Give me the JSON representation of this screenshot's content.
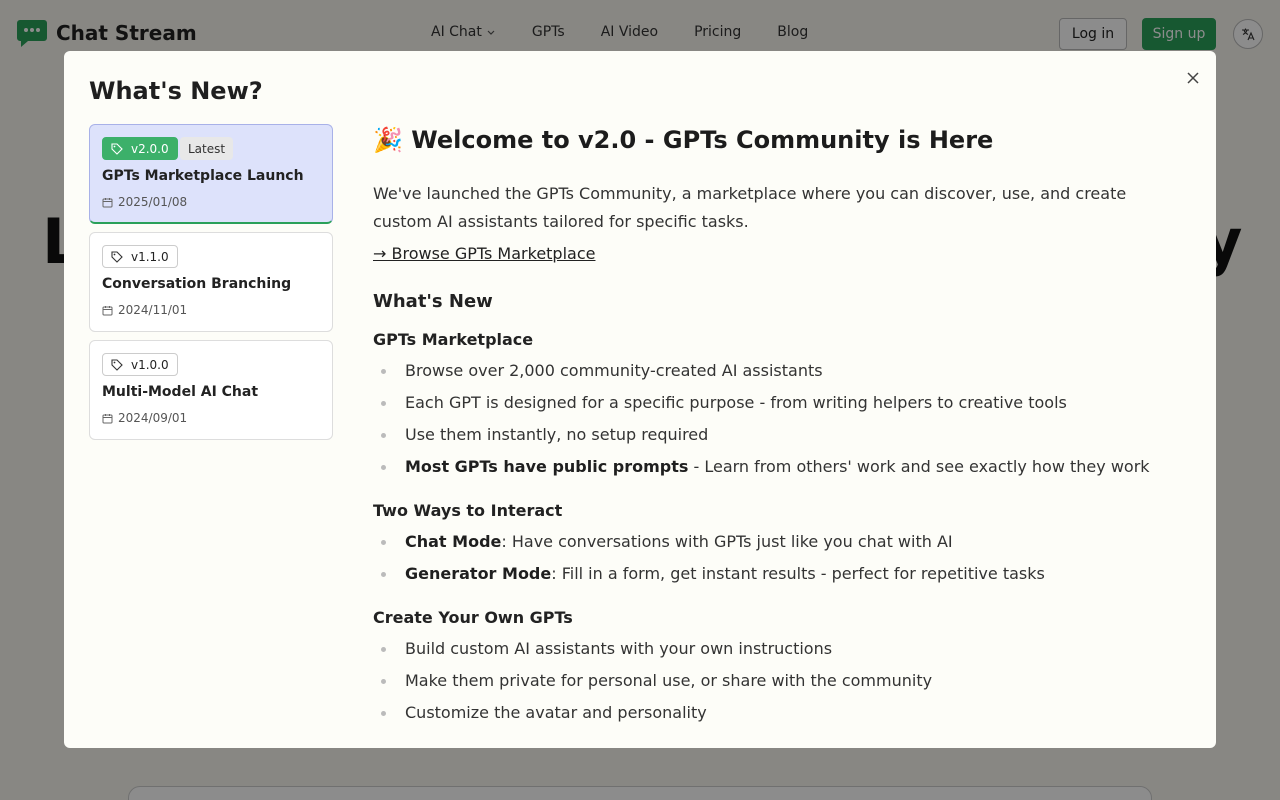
{
  "app": {
    "name": "Chat Stream"
  },
  "nav": {
    "items": [
      "AI Chat",
      "GPTs",
      "AI Video",
      "Pricing",
      "Blog"
    ],
    "login": "Log in",
    "signup": "Sign up"
  },
  "hero": {
    "left_glyph": "L",
    "right_glyph": "y"
  },
  "modal": {
    "title": "What's New?",
    "versions": [
      {
        "tag": "v2.0.0",
        "badge": "Latest",
        "title": "GPTs Marketplace Launch",
        "date": "2025/01/08",
        "active": true
      },
      {
        "tag": "v1.1.0",
        "title": "Conversation Branching",
        "date": "2024/11/01"
      },
      {
        "tag": "v1.0.0",
        "title": "Multi-Model AI Chat",
        "date": "2024/09/01"
      }
    ],
    "content": {
      "heading": "🎉 Welcome to v2.0 - GPTs Community is Here",
      "intro": "We've launched the GPTs Community, a marketplace where you can discover, use, and create custom AI assistants tailored for specific tasks.",
      "link": "→ Browse GPTs Marketplace",
      "whats_new": "What's New",
      "sections": [
        {
          "title": "GPTs Marketplace",
          "items": [
            {
              "bold": "",
              "text": "Browse over 2,000 community-created AI assistants"
            },
            {
              "bold": "",
              "text": "Each GPT is designed for a specific purpose - from writing helpers to creative tools"
            },
            {
              "bold": "",
              "text": "Use them instantly, no setup required"
            },
            {
              "bold": "Most GPTs have public prompts",
              "text": " - Learn from others' work and see exactly how they work"
            }
          ]
        },
        {
          "title": "Two Ways to Interact",
          "items": [
            {
              "bold": "Chat Mode",
              "text": ": Have conversations with GPTs just like you chat with AI"
            },
            {
              "bold": "Generator Mode",
              "text": ": Fill in a form, get instant results - perfect for repetitive tasks"
            }
          ]
        },
        {
          "title": "Create Your Own GPTs",
          "items": [
            {
              "bold": "",
              "text": "Build custom AI assistants with your own instructions"
            },
            {
              "bold": "",
              "text": "Make them private for personal use, or share with the community"
            },
            {
              "bold": "",
              "text": "Customize the avatar and personality"
            }
          ]
        }
      ]
    }
  },
  "colors": {
    "brand": "#2aa05a",
    "active_card": "#dde2fb"
  },
  "icons": [
    "chat-logo-icon",
    "chevron-down-icon",
    "translate-icon",
    "close-icon",
    "tag-icon",
    "calendar-icon"
  ]
}
